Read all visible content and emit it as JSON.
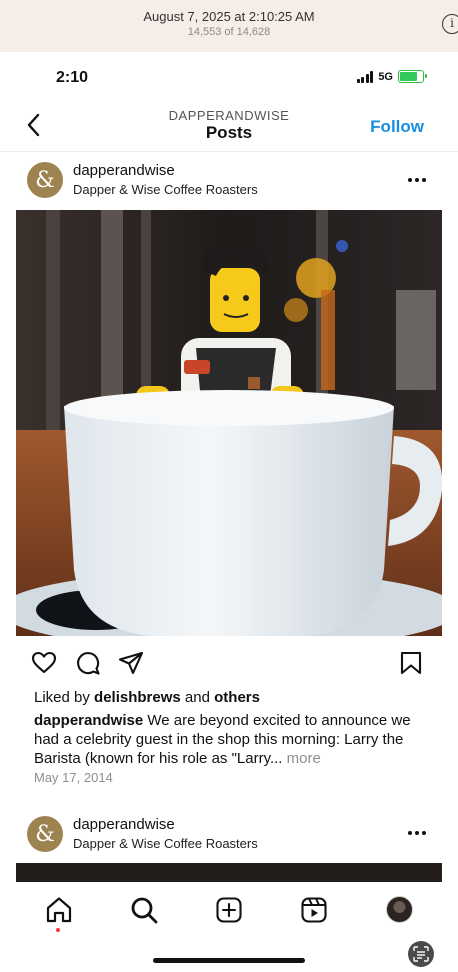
{
  "viewer": {
    "date": "August 7, 2025 at 2:10:25 AM",
    "count": "14,553 of 14,628",
    "info_icon": "info-icon"
  },
  "status_bar": {
    "time": "2:10",
    "network": "5G",
    "icons": [
      "signal-icon",
      "battery-icon"
    ]
  },
  "header": {
    "username": "DAPPERANDWISE",
    "title": "Posts",
    "follow_label": "Follow"
  },
  "posts": [
    {
      "avatar_glyph": "&",
      "username": "dapperandwise",
      "subtitle": "Dapper & Wise Coffee Roasters",
      "image_description_icon": "lego-barista-photo",
      "likes_prefix": "Liked by",
      "likes_user": "delishbrews",
      "likes_and": "and",
      "likes_others": "others",
      "caption_user": "dapperandwise",
      "caption_text": "We are beyond excited to announce we had a celebrity guest in the shop this morning: Larry the Barista (known for his role as \"Larry...",
      "caption_more": "more",
      "date": "May 17, 2014"
    },
    {
      "avatar_glyph": "&",
      "username": "dapperandwise",
      "subtitle": "Dapper & Wise Coffee Roasters"
    }
  ],
  "action_icons": [
    "heart-icon",
    "comment-icon",
    "share-icon",
    "bookmark-icon"
  ],
  "tabs": [
    "home-icon",
    "search-icon",
    "create-icon",
    "reels-icon",
    "profile-icon"
  ],
  "colors": {
    "follow_blue": "#1a8fe0",
    "avatar_gold": "#9c8350",
    "notification_red": "#ff3040"
  }
}
